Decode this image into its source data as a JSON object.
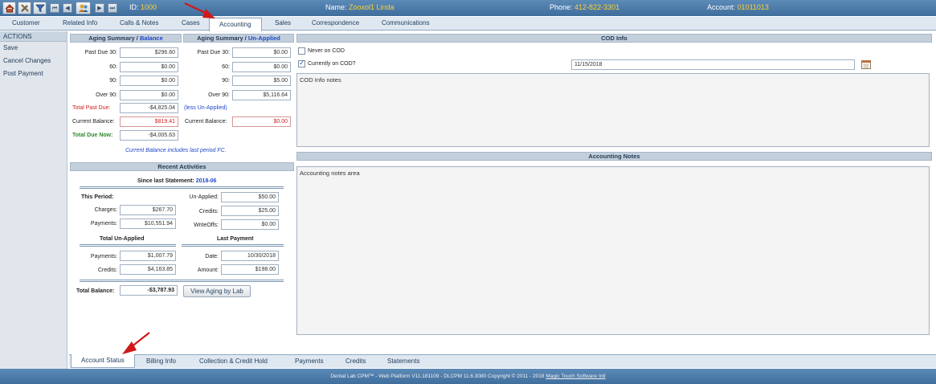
{
  "header": {
    "id_label": "ID:",
    "id_value": "1000",
    "name_label": "Name:",
    "name_value": "Zooxol1 Linda",
    "phone_label": "Phone:",
    "phone_value": "412-822-3301",
    "account_label": "Account:",
    "account_value": "01011013",
    "toolbar_icons": [
      "home-icon",
      "tools-icon",
      "filter-icon",
      "first-record-icon",
      "previous-record-icon",
      "people-icon",
      "next-record-icon",
      "last-record-icon"
    ],
    "nav_glyphs": {
      "first": "⏮",
      "prev": "◀",
      "next": "▶",
      "last": "⏭"
    }
  },
  "tabs": [
    "Customer",
    "Related Info",
    "Calls & Notes",
    "Cases",
    "Accounting",
    "Sales",
    "Correspondence",
    "Communications"
  ],
  "active_tab": "Accounting",
  "sidebar": {
    "header": "ACTIONS",
    "items": [
      "Save",
      "Cancel Changes",
      "Post Payment"
    ]
  },
  "aging_balance": {
    "title_a": "Aging Summary / ",
    "title_b": "Balance",
    "rows": [
      {
        "label": "Past Due 30:",
        "value": "$296.60"
      },
      {
        "label": "60:",
        "value": "$0.00"
      },
      {
        "label": "90:",
        "value": "$0.00"
      },
      {
        "label": "Over 90:",
        "value": "$0.00"
      }
    ],
    "total_past_due_label": "Total Past Due:",
    "total_past_due_value": "-$4,825.04",
    "current_balance_label": "Current Balance:",
    "current_balance_value": "$819.41",
    "total_due_now_label": "Total Due Now:",
    "total_due_now_value": "-$4,005.63"
  },
  "aging_unapplied": {
    "title_a": "Aging Summary / ",
    "title_b": "Un-Applied",
    "rows": [
      {
        "label": "Past Due 30:",
        "value": "$0.00"
      },
      {
        "label": "60:",
        "value": "$0.00"
      },
      {
        "label": "90:",
        "value": "$5.00"
      },
      {
        "label": "Over 90:",
        "value": "$5,116.64"
      }
    ],
    "less_note": "(less Un-Applied)",
    "current_balance_label": "Current Balance:",
    "current_balance_value": "$0.00"
  },
  "balance_note": "Current Balance includes last period FC.",
  "recent": {
    "title": "Recent Activities",
    "since_label": "Since last Statement:",
    "since_value": "2018-06",
    "this_period_label": "This Period:",
    "charges_label": "Charges:",
    "charges_value": "$267.70",
    "payments_label": "Payments:",
    "payments_value": "$10,551.94",
    "unapplied_label": "Un-Applied:",
    "unapplied_value": "$50.00",
    "credits_label": "Credits:",
    "credits_value": "$25.00",
    "writeoffs_label": "WriteOffs:",
    "writeoffs_value": "$0.00",
    "total_unapplied_title": "Total Un-Applied",
    "last_payment_title": "Last Payment",
    "tu_payments_label": "Payments:",
    "tu_payments_value": "$1,007.79",
    "tu_credits_label": "Credits:",
    "tu_credits_value": "$4,163.85",
    "lp_date_label": "Date:",
    "lp_date_value": "10/30/2018",
    "lp_amount_label": "Amount:",
    "lp_amount_value": "$198.00",
    "total_balance_label": "Total Balance:",
    "total_balance_value": "-$3,787.93",
    "view_aging_button": "View Aging by Lab"
  },
  "cod": {
    "title": "COD Info",
    "never_label": "Never on COD",
    "never_checked": false,
    "currently_label": "Currently on COD?",
    "currently_checked": true,
    "date_value": "11/15/2018",
    "notes": "COD Info notes"
  },
  "accounting_notes": {
    "title": "Accounting Notes",
    "text": "Accounting notes area"
  },
  "bottom_tabs": [
    "Account Status",
    "Billing Info",
    "Collection & Credit Hold",
    "Payments",
    "Credits",
    "Statements"
  ],
  "active_bottom_tab": "Account Status",
  "footer": {
    "text": "Dental Lab CPM™ - Web Platform V11.181109 - DLCPM 11.6.3080      Copyright © 2011 - 2018 ",
    "link": "Magic Touch Software Intl"
  },
  "colors": {
    "header_blue": "#4a78a7",
    "header_value_yellow": "#ffd233",
    "accent_red": "#cc2222",
    "accent_green": "#2d8a2d",
    "link_blue": "#1f48c9",
    "annotation_arrow": "#d01818"
  }
}
